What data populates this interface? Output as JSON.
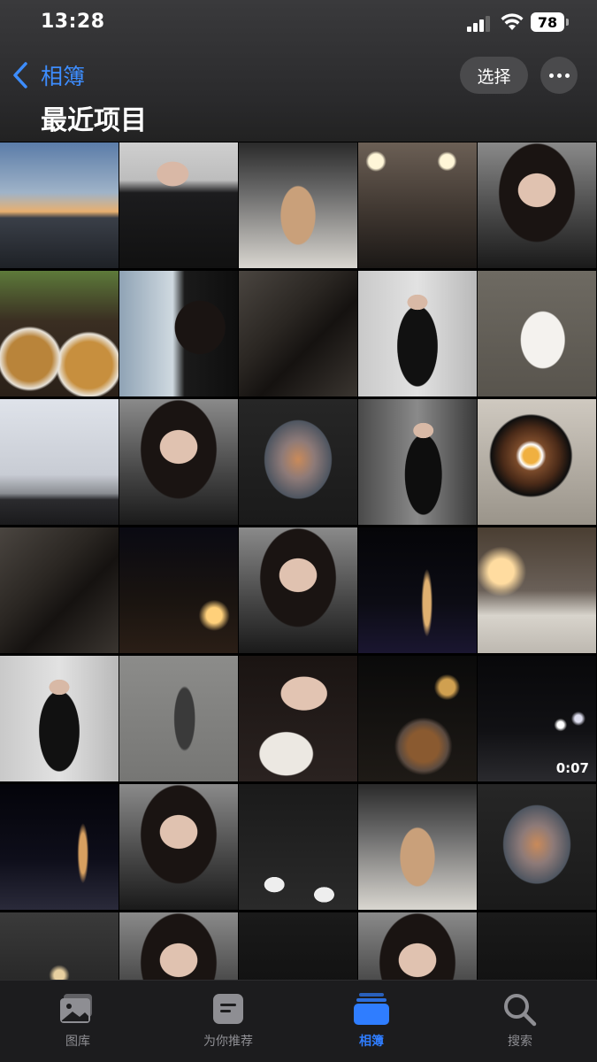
{
  "status": {
    "time": "13:28",
    "battery": "78"
  },
  "nav": {
    "back_label": "相簿",
    "select_label": "选择",
    "title": "最近项目"
  },
  "grid": {
    "tiles": [
      {
        "icon": "city-sunset-photo"
      },
      {
        "icon": "selfie-photo"
      },
      {
        "icon": "iced-coffee-photo"
      },
      {
        "icon": "vanity-mirror-photo"
      },
      {
        "icon": "portrait-photo"
      },
      {
        "icon": "food-table-photo"
      },
      {
        "icon": "car-window-photo"
      },
      {
        "icon": "legs-photo"
      },
      {
        "icon": "mirror-selfie-photo"
      },
      {
        "icon": "dog-photo"
      },
      {
        "icon": "laptop-photo"
      },
      {
        "icon": "portrait-photo"
      },
      {
        "icon": "airplane-window-photo"
      },
      {
        "icon": "gym-selfie-photo"
      },
      {
        "icon": "rice-bowl-photo"
      },
      {
        "icon": "legs-photo"
      },
      {
        "icon": "wine-night-photo"
      },
      {
        "icon": "portrait-photo"
      },
      {
        "icon": "night-tower-photo"
      },
      {
        "icon": "hotel-room-photo"
      },
      {
        "icon": "mirror-selfie-photo"
      },
      {
        "icon": "shadow-photo"
      },
      {
        "icon": "portrait-dog-photo"
      },
      {
        "icon": "dinner-photo"
      },
      {
        "icon": "night-road-video",
        "duration": "0:07"
      },
      {
        "icon": "night-skyline-photo"
      },
      {
        "icon": "portrait-photo"
      },
      {
        "icon": "sneakers-photo"
      },
      {
        "icon": "iced-coffee-photo"
      },
      {
        "icon": "airplane-window-photo"
      },
      {
        "icon": "restaurant-photo"
      },
      {
        "icon": "portrait-photo"
      },
      {
        "icon": "dark-photo"
      },
      {
        "icon": "portrait-photo"
      },
      {
        "icon": "dark-photo"
      }
    ]
  },
  "tabs": [
    {
      "label": "图库",
      "icon": "library-icon",
      "active": false
    },
    {
      "label": "为你推荐",
      "icon": "for-you-icon",
      "active": false
    },
    {
      "label": "相簿",
      "icon": "albums-icon",
      "active": true
    },
    {
      "label": "搜索",
      "icon": "search-icon",
      "active": false
    }
  ],
  "colors": {
    "accent": "#3d8dff",
    "tab_inactive": "#8e8e93",
    "background": "#000000"
  }
}
